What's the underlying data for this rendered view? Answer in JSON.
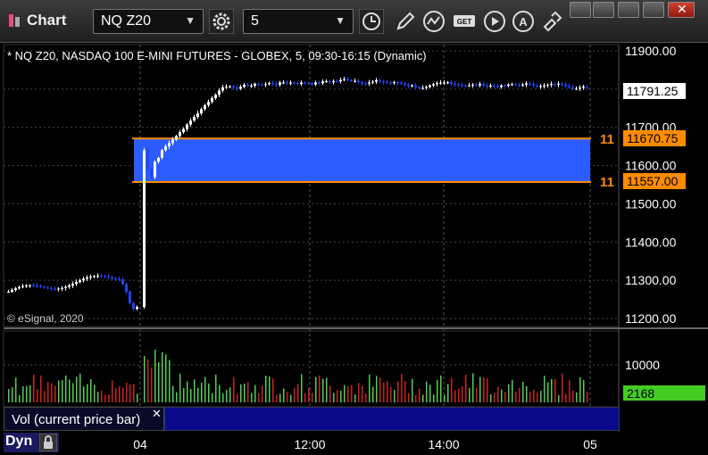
{
  "toolbar": {
    "app_title": "Chart",
    "symbol": "NQ Z20",
    "interval": "5"
  },
  "chart": {
    "header": "* NQ Z20, NASDAQ 100 E-MINI FUTURES - GLOBEX, 5, 09:30-16:15 (Dynamic)",
    "watermark": "© eSignal, 2020",
    "last_price_label": "11791.25",
    "zone_top_label": "11670.75",
    "zone_bottom_label": "11557.00",
    "zone_top_short": "11",
    "zone_bottom_short": "11",
    "volume_label": "2168",
    "volume_tick": "10000",
    "volume_panel_title": "Vol (current price bar)",
    "dyn": "Dyn"
  },
  "chart_data": {
    "type": "candlestick",
    "title": "* NQ Z20, NASDAQ 100 E-MINI FUTURES - GLOBEX, 5, 09:30-16:15 (Dynamic)",
    "y_ticks": [
      "11900.00",
      "11800.00",
      "11700.00",
      "11600.00",
      "11500.00",
      "11400.00",
      "11300.00",
      "11200.00"
    ],
    "x_ticks": [
      "04",
      "12:00",
      "14:00",
      "05"
    ],
    "ylim": [
      11200,
      11900
    ],
    "zone": {
      "top": 11670.75,
      "bottom": 11557.0
    },
    "last_price": 11791.25,
    "volume": {
      "y_ticks": [
        "10000"
      ],
      "last": 2168
    }
  },
  "colors": {
    "up": "#ffffff",
    "down": "#2244ff",
    "zone_fill": "#2a5cff",
    "zone_line": "#ff8c00",
    "vol_up": "#55cc55",
    "vol_down": "#cc2222"
  }
}
